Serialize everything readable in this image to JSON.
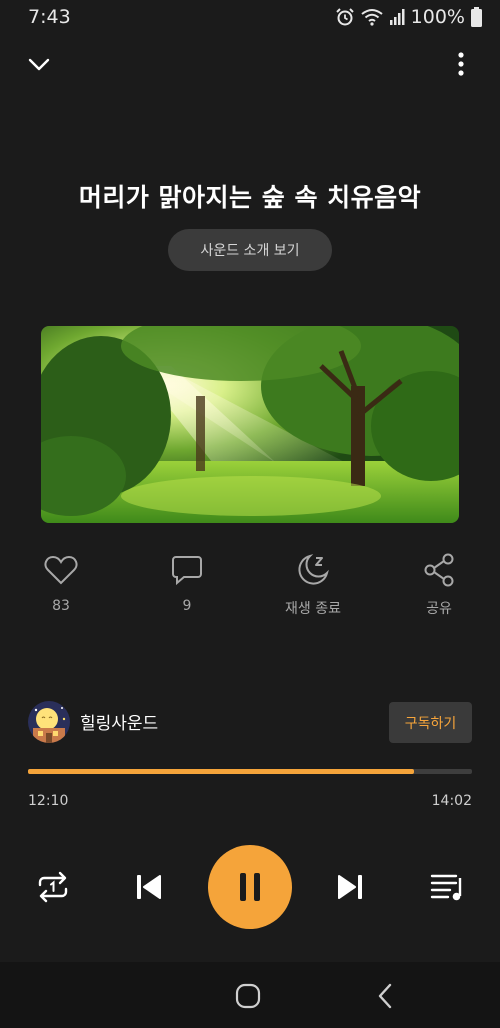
{
  "status_bar": {
    "time": "7:43",
    "battery": "100%"
  },
  "track": {
    "title": "머리가 맑아지는 숲 속 치유음악",
    "intro_label": "사운드 소개 보기"
  },
  "actions": [
    {
      "icon": "heart-icon",
      "label": "83"
    },
    {
      "icon": "comment-icon",
      "label": "9"
    },
    {
      "icon": "sleep-timer-icon",
      "label": "재생 종료"
    },
    {
      "icon": "share-icon",
      "label": "공유"
    }
  ],
  "channel": {
    "name": "힐링사운드",
    "subscribe_label": "구독하기"
  },
  "playback": {
    "current_time": "12:10",
    "total_time": "14:02",
    "progress": 0.869
  },
  "colors": {
    "accent": "#f5a43a",
    "background": "#1b1b1b"
  }
}
